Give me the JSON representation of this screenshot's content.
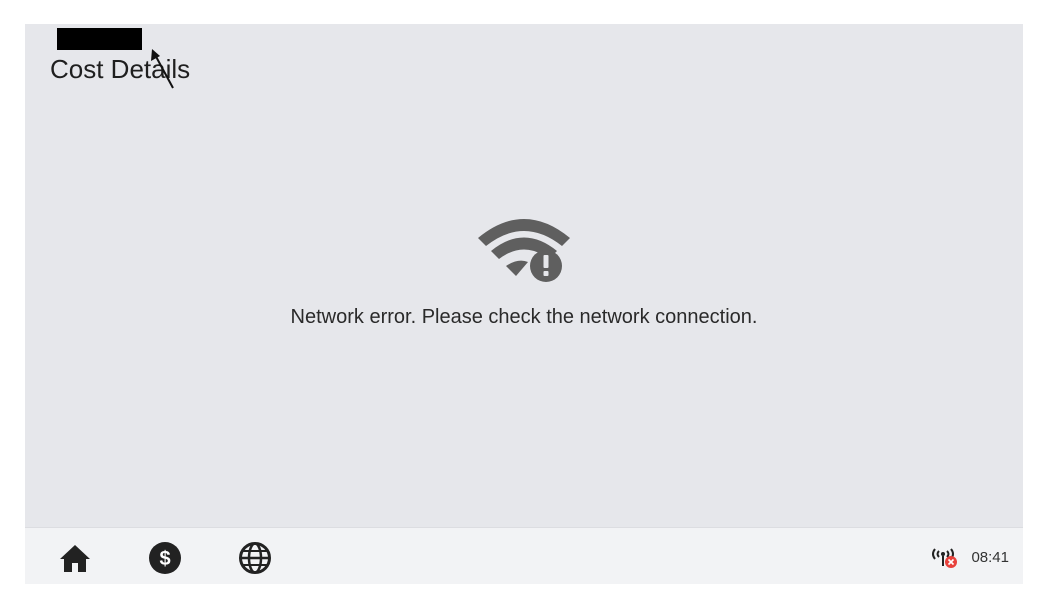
{
  "page": {
    "title": "Cost Details"
  },
  "error": {
    "icon": "wifi-error-icon",
    "message": "Network error. Please check the network connection."
  },
  "bottom_bar": {
    "nav": [
      {
        "name": "home",
        "icon": "home-icon"
      },
      {
        "name": "cost",
        "icon": "dollar-icon"
      },
      {
        "name": "network",
        "icon": "globe-icon"
      }
    ],
    "status": {
      "signal_icon": "signal-disconnected-icon",
      "time": "08:41"
    }
  },
  "colors": {
    "background": "#e6e7eb",
    "icon": "#5f5f5f",
    "status_error": "#e8413c"
  }
}
